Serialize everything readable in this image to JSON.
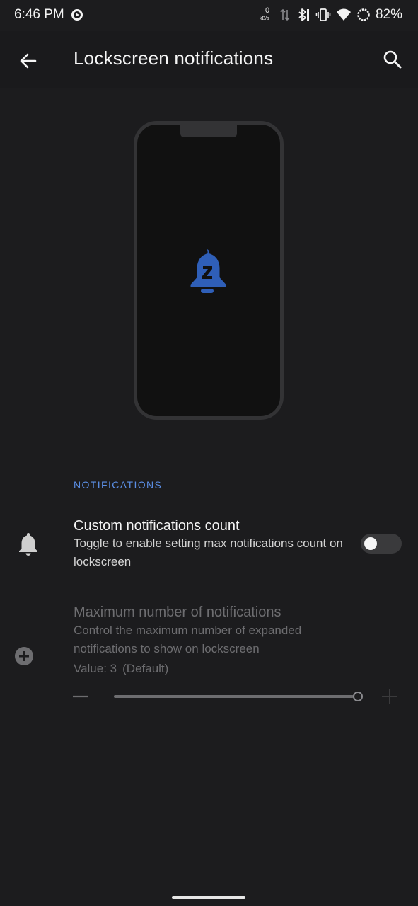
{
  "status_bar": {
    "time": "6:46 PM",
    "net_speed_value": "0",
    "net_speed_unit": "kB/s",
    "battery_percent": "82%"
  },
  "app_bar": {
    "title": "Lockscreen notifications"
  },
  "section": {
    "header": "NOTIFICATIONS"
  },
  "custom_count": {
    "title": "Custom notifications count",
    "summary": "Toggle to enable setting max notifications count on lockscreen",
    "enabled": false
  },
  "max_notifications": {
    "title": "Maximum number of notifications",
    "summary": "Control the maximum number of expanded notifications to show on lockscreen",
    "value_label": "Value: 3",
    "default_label": "(Default)",
    "disabled": true
  },
  "colors": {
    "accent": "#5b8fe6",
    "background": "#1c1c1e",
    "icon_blue": "#2f5fb8"
  },
  "icons": {
    "back": "arrow-left-icon",
    "search": "search-icon",
    "bell_snooze": "bell-z-icon",
    "bell": "bell-icon",
    "add_circle": "add-circle-icon"
  }
}
